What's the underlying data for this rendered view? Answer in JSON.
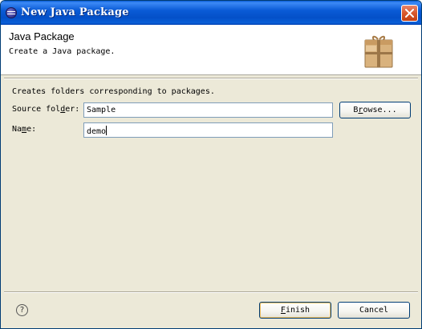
{
  "window": {
    "title": "New Java Package",
    "close_icon": "close-icon",
    "app_icon": "eclipse-icon"
  },
  "banner": {
    "title": "Java Package",
    "description": "Create a Java package.",
    "icon": "package-icon"
  },
  "form": {
    "info": "Creates folders corresponding to packages.",
    "source_folder": {
      "label_pre": "Source fol",
      "label_mnemonic": "d",
      "label_post": "er:",
      "value": "Sample"
    },
    "name": {
      "label_pre": "Na",
      "label_mnemonic": "m",
      "label_post": "e:",
      "value": "demo"
    },
    "browse_pre": "B",
    "browse_mnemonic": "r",
    "browse_post": "owse..."
  },
  "footer": {
    "help_glyph": "?",
    "finish_mnemonic": "F",
    "finish_rest": "inish",
    "cancel_label": "Cancel"
  },
  "colors": {
    "titlebar": "#0a5bd6",
    "dialog_bg": "#ece9d8",
    "field_border": "#7f9db9"
  }
}
